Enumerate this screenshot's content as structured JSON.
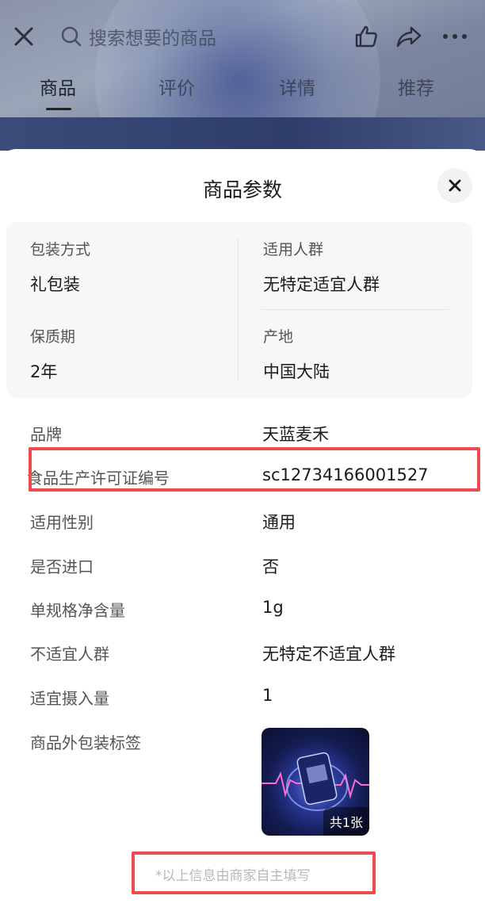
{
  "header": {
    "search_placeholder": "搜索想要的商品",
    "icons": [
      "close-icon",
      "search-icon",
      "thumbs-up-icon",
      "share-icon",
      "more-icon"
    ],
    "tabs": [
      {
        "label": "商品",
        "active": true
      },
      {
        "label": "评价",
        "active": false
      },
      {
        "label": "详情",
        "active": false
      },
      {
        "label": "推荐",
        "active": false
      }
    ]
  },
  "sheet": {
    "title": "商品参数",
    "card": [
      {
        "label": "包装方式",
        "value": "礼包装"
      },
      {
        "label": "适用人群",
        "value": "无特定适宜人群"
      },
      {
        "label": "保质期",
        "value": "2年"
      },
      {
        "label": "产地",
        "value": "中国大陆"
      }
    ],
    "rows": [
      {
        "label": "品牌",
        "value": "天蓝麦禾"
      },
      {
        "label": "食品生产许可证编号",
        "value": "sc12734166001527"
      },
      {
        "label": "适用性别",
        "value": "通用"
      },
      {
        "label": "是否进口",
        "value": "否"
      },
      {
        "label": "单规格净含量",
        "value": "1g"
      },
      {
        "label": "不适宜人群",
        "value": "无特定不适宜人群"
      },
      {
        "label": "适宜摄入量",
        "value": "1"
      },
      {
        "label": "商品外包装标签",
        "value": ""
      }
    ],
    "label_image_count": "共1张",
    "footnote": "*以上信息由商家自主填写"
  },
  "colors": {
    "highlight": "#ec4b50",
    "card_bg": "#f6f7f9",
    "label_text": "#555555",
    "value_text": "#1a1a1a"
  }
}
